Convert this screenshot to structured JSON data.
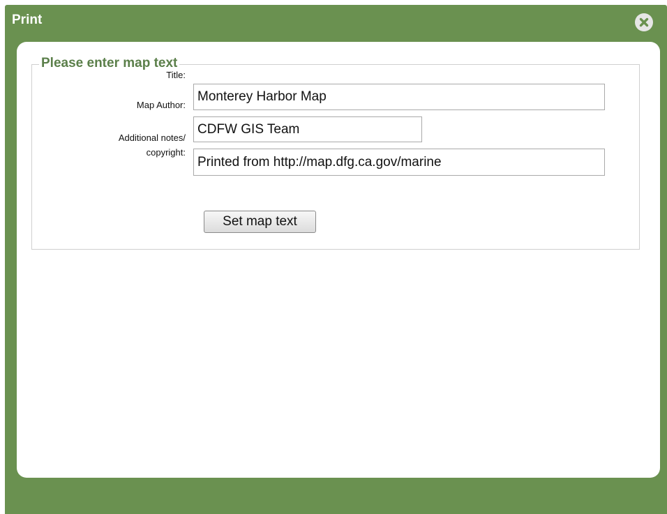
{
  "dialog": {
    "title": "Print",
    "close_icon": "close-circle-icon"
  },
  "form": {
    "legend": "Please enter map text",
    "title_label": "Title:",
    "title_value": "Monterey Harbor Map",
    "author_label": "Map Author:",
    "author_value": "CDFW GIS Team",
    "notes_label_line1": "Additional notes/",
    "notes_label_line2": "copyright:",
    "notes_value": "Printed from http://map.dfg.ca.gov/marine",
    "submit_label": "Set map text"
  },
  "colors": {
    "frame": "#6a9150",
    "legend": "#5b7f4a"
  }
}
